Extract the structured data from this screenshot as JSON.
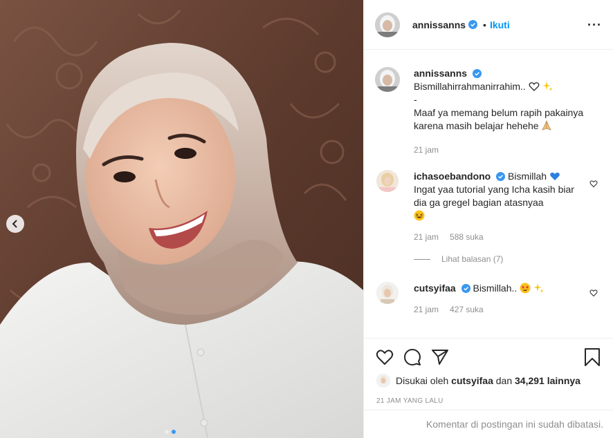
{
  "post_author": {
    "username": "annissanns",
    "follow_label": "Ikuti",
    "follow_separator": "•"
  },
  "caption": {
    "username": "annissanns",
    "line1": "Bismillahirrahmanirrahim..",
    "line2": "-",
    "line3": "Maaf ya memang belum rapih pakainya karena masih belajar hehehe",
    "time": "21 jam"
  },
  "comments": [
    {
      "username": "ichasoebandono",
      "text_first": "Bismillah",
      "text_rest": "Ingat yaa tutorial yang Icha kasih biar dia ga gregel bagian atasnyaa",
      "time": "21 jam",
      "likes": "588 suka",
      "view_replies": "Lihat balasan (7)"
    },
    {
      "username": "cutsyifaa",
      "text_first": "Bismillah..",
      "time": "21 jam",
      "likes": "427 suka"
    }
  ],
  "liked_by": {
    "prefix": "Disukai oleh",
    "user": "cutsyifaa",
    "middle": "dan",
    "count": "34,291 lainnya"
  },
  "date_label": "21 JAM YANG LALU",
  "comments_disabled": "Komentar di postingan ini sudah dibatasi.",
  "colors": {
    "link_blue": "#0095f6",
    "verified_blue": "#3897f0",
    "muted_grey": "#8e8e8e",
    "curtain_brown": "#6b4436"
  },
  "icons": [
    "chevron-left-icon",
    "more-icon",
    "verified-icon",
    "heart-icon",
    "comment-icon",
    "share-icon",
    "bookmark-icon"
  ]
}
